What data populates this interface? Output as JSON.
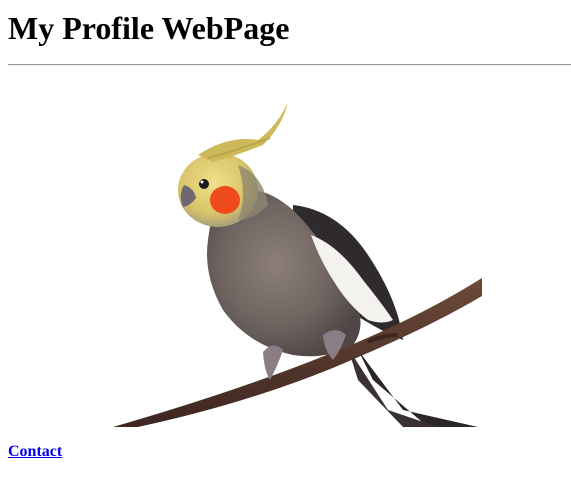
{
  "page": {
    "title": "My Profile WebPage"
  },
  "image": {
    "subject": "cockatiel-photo",
    "icon": "bird-icon"
  },
  "nav": {
    "contact_label": "Contact"
  },
  "colors": {
    "link": "#0000ee",
    "rule": "#9a9a9a",
    "background": "#ffffff"
  }
}
